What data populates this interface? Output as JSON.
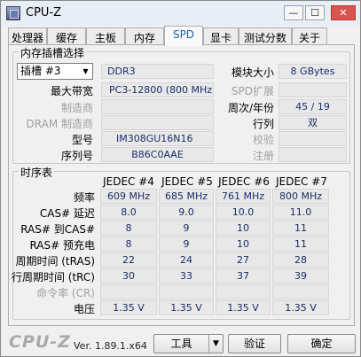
{
  "window": {
    "title": "CPU-Z",
    "minimize": "—",
    "maximize": "☐",
    "close": "✕"
  },
  "tabs": [
    "处理器",
    "缓存",
    "主板",
    "内存",
    "SPD",
    "显卡",
    "测试分数",
    "关于"
  ],
  "active_tab": "SPD",
  "slot": {
    "group_title": "内存插槽选择",
    "selected": "插槽 #3",
    "type": "DDR3",
    "module_size_label": "模块大小",
    "module_size": "8 GBytes",
    "max_bw_label": "最大带宽",
    "max_bw": "PC3-12800 (800 MHz)",
    "spd_ext_label": "SPD扩展",
    "spd_ext": "",
    "manufacturer_label": "制造商",
    "manufacturer": "",
    "week_year_label": "周次/年份",
    "week_year": "45 / 19",
    "dram_mfr_label": "DRAM 制造商",
    "dram_mfr": "",
    "ranks_label": "行列",
    "ranks": "双",
    "part_label": "型号",
    "part": "IM308GU16N16",
    "correction_label": "校验",
    "correction": "",
    "serial_label": "序列号",
    "serial": "B86C0AAE",
    "registered_label": "注册",
    "registered": ""
  },
  "timings": {
    "group_title": "时序表",
    "columns": [
      "JEDEC #4",
      "JEDEC #5",
      "JEDEC #6",
      "JEDEC #7"
    ],
    "rows": [
      {
        "label": "频率",
        "values": [
          "609 MHz",
          "685 MHz",
          "761 MHz",
          "800 MHz"
        ],
        "dim": false
      },
      {
        "label": "CAS# 延迟",
        "values": [
          "8.0",
          "9.0",
          "10.0",
          "11.0"
        ],
        "dim": false
      },
      {
        "label": "RAS# 到CAS#",
        "values": [
          "8",
          "9",
          "10",
          "11"
        ],
        "dim": false
      },
      {
        "label": "RAS# 预充电",
        "values": [
          "8",
          "9",
          "10",
          "11"
        ],
        "dim": false
      },
      {
        "label": "周期时间 (tRAS)",
        "values": [
          "22",
          "24",
          "27",
          "28"
        ],
        "dim": false
      },
      {
        "label": "行周期时间 (tRC)",
        "values": [
          "30",
          "33",
          "37",
          "39"
        ],
        "dim": false
      },
      {
        "label": "命令率 (CR)",
        "values": [
          "",
          "",
          "",
          ""
        ],
        "dim": true
      },
      {
        "label": "电压",
        "values": [
          "1.35 V",
          "1.35 V",
          "1.35 V",
          "1.35 V"
        ],
        "dim": false
      }
    ]
  },
  "footer": {
    "logo": "CPU-Z",
    "version": "Ver. 1.89.1.x64",
    "tools_label": "工具",
    "validate_label": "验证",
    "ok_label": "确定"
  }
}
